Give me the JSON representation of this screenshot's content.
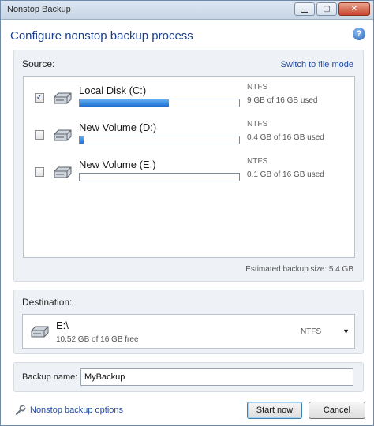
{
  "window": {
    "title": "Nonstop Backup",
    "controls": {
      "minimize": "▁",
      "maximize": "▢",
      "close": "✕"
    }
  },
  "header": {
    "title": "Configure nonstop backup process",
    "help_icon": "?"
  },
  "source": {
    "label": "Source:",
    "switch_link": "Switch to file mode",
    "disks": [
      {
        "name": "Local Disk (C:)",
        "fs": "NTFS",
        "usage": "9 GB of 16 GB used",
        "used_fraction": 0.56,
        "checked": true
      },
      {
        "name": "New Volume (D:)",
        "fs": "NTFS",
        "usage": "0.4 GB of 16 GB used",
        "used_fraction": 0.025,
        "checked": false
      },
      {
        "name": "New Volume (E:)",
        "fs": "NTFS",
        "usage": "0.1 GB of 16 GB used",
        "used_fraction": 0.006,
        "checked": false
      }
    ],
    "estimated": "Estimated backup size: 5.4 GB"
  },
  "destination": {
    "label": "Destination:",
    "path": "E:\\",
    "free": "10.52 GB of 16 GB free",
    "fs": "NTFS",
    "arrow": "▼"
  },
  "backup_name": {
    "label": "Backup name:",
    "value": "MyBackup"
  },
  "footer": {
    "options_link": "Nonstop backup options",
    "start_button": "Start now",
    "cancel_button": "Cancel"
  },
  "colors": {
    "link": "#1f4aa8",
    "heading": "#1c3f8a",
    "bar_fill": "#1c6fd0"
  }
}
